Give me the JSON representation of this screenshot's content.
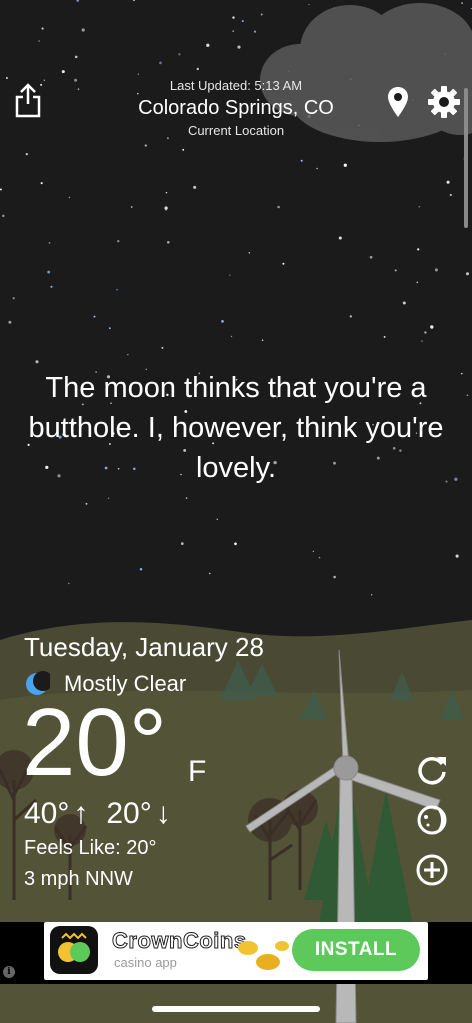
{
  "header": {
    "last_updated": "Last Updated: 5:13 AM",
    "city": "Colorado Springs, CO",
    "location_label": "Current Location"
  },
  "icons": {
    "share": "share-icon",
    "location": "location-pin-icon",
    "settings": "gear-icon",
    "refresh": "refresh-icon",
    "moon_phase": "moon-phase-icon",
    "add": "add-icon",
    "condition": "crescent-moon-icon"
  },
  "quote": "The moon thinks that you're a butthole. I, however, think you're lovely.",
  "weather": {
    "date": "Tuesday, January 28",
    "condition": "Mostly Clear",
    "temperature": "20°",
    "unit": "F",
    "high": "40°",
    "low": "20°",
    "high_arrow": "↑",
    "low_arrow": "↓",
    "feels_like": "Feels Like: 20°",
    "wind": "3 mph NNW"
  },
  "ad": {
    "app_name": "CrownCoins",
    "app_subtitle": "casino app",
    "install_label": "INSTALL",
    "info_label": "i"
  },
  "colors": {
    "sky": "#1b1b1b",
    "ground": "#4a4a34",
    "install": "#5ec95b",
    "condition_icon": "#4aa3f0"
  }
}
